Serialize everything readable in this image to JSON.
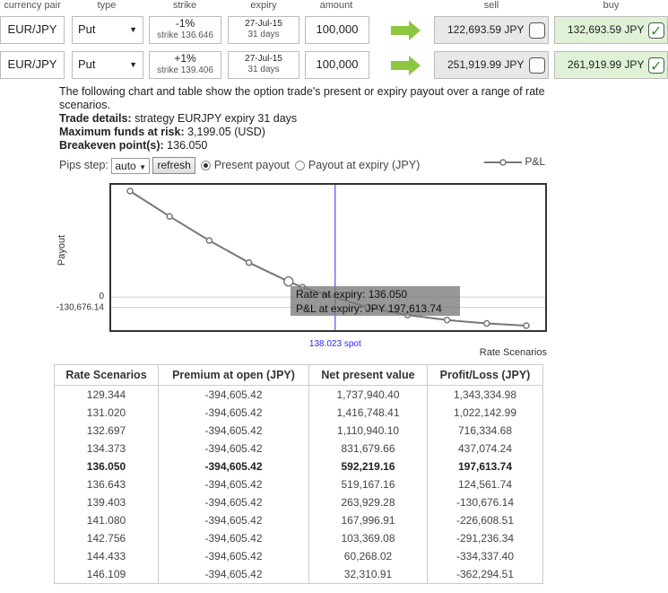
{
  "headers": {
    "pair": "currency pair",
    "type": "type",
    "strike": "strike",
    "expiry": "expiry",
    "amount": "amount",
    "sell": "sell",
    "buy": "buy"
  },
  "rows": [
    {
      "pair": "EUR/JPY",
      "type": "Put",
      "strike_pct": "-1%",
      "strike": "strike 136.646",
      "expiry_date": "27-Jul-15",
      "expiry_days": "31 days",
      "amount": "100,000",
      "sell": "122,693.59 JPY",
      "sell_checked": false,
      "buy": "132,693.59 JPY",
      "buy_checked": true
    },
    {
      "pair": "EUR/JPY",
      "type": "Put",
      "strike_pct": "+1%",
      "strike": "strike 139.406",
      "expiry_date": "27-Jul-15",
      "expiry_days": "31 days",
      "amount": "100,000",
      "sell": "251,919.99 JPY",
      "sell_checked": false,
      "buy": "261,919.99 JPY",
      "buy_checked": true
    }
  ],
  "info": {
    "intro": "The following chart and table show the option trade's present or expiry payout over a range of rate scenarios.",
    "trade_label": "Trade details:",
    "trade_value": " strategy EURJPY expiry 31 days",
    "funds_label": "Maximum funds at risk:",
    "funds_value": " 3,199.05 (USD)",
    "breakeven_label": "Breakeven point(s):",
    "breakeven_value": " 136.050"
  },
  "controls": {
    "pips_label": "Pips step:",
    "pips_value": "auto",
    "refresh": "refresh",
    "present": "Present payout",
    "expiry": "Payout at expiry (JPY)"
  },
  "legend": "P&L",
  "chart_data": {
    "type": "line",
    "xlabel": "Rate Scenarios",
    "ylabel": "Payout",
    "y_ticks": [
      "0",
      "-130,676.14"
    ],
    "spot_label": "138.023 spot",
    "spot_x": 138.023,
    "series": [
      {
        "name": "P&L",
        "x": [
          129.344,
          131.02,
          132.697,
          134.373,
          136.05,
          136.643,
          139.403,
          141.08,
          142.756,
          144.433,
          146.109
        ],
        "y": [
          1343334.98,
          1022142.99,
          716334.68,
          437074.24,
          197613.74,
          124561.74,
          -130676.14,
          -226608.51,
          -291236.34,
          -334337.4,
          -362294.51
        ]
      }
    ],
    "tooltip": {
      "line1": "Rate at expiry: 136.050",
      "line2": "P&L at expiry: JPY 197,613.74"
    }
  },
  "table": {
    "headers": [
      "Rate Scenarios",
      "Premium at open (JPY)",
      "Net present value",
      "Profit/Loss (JPY)"
    ],
    "rows": [
      [
        "129.344",
        "-394,605.42",
        "1,737,940.40",
        "1,343,334.98"
      ],
      [
        "131.020",
        "-394,605.42",
        "1,416,748.41",
        "1,022,142.99"
      ],
      [
        "132.697",
        "-394,605.42",
        "1,110,940.10",
        "716,334.68"
      ],
      [
        "134.373",
        "-394,605.42",
        "831,679.66",
        "437,074.24"
      ],
      [
        "136.050",
        "-394,605.42",
        "592,219.16",
        "197,613.74"
      ],
      [
        "136.643",
        "-394,605.42",
        "519,167.16",
        "124,561.74"
      ],
      [
        "139.403",
        "-394,605.42",
        "263,929.28",
        "-130,676.14"
      ],
      [
        "141.080",
        "-394,605.42",
        "167,996.91",
        "-226,608.51"
      ],
      [
        "142.756",
        "-394,605.42",
        "103,369.08",
        "-291,236.34"
      ],
      [
        "144.433",
        "-394,605.42",
        "60,268.02",
        "-334,337.40"
      ],
      [
        "146.109",
        "-394,605.42",
        "32,310.91",
        "-362,294.51"
      ]
    ],
    "bold_row": 4
  },
  "colors": {
    "arrow": "#8dc63f",
    "buy_bg": "#dff2d6",
    "sell_bg": "#e8e8e8",
    "spot_line": "#2a2aff",
    "series": "#777777"
  }
}
